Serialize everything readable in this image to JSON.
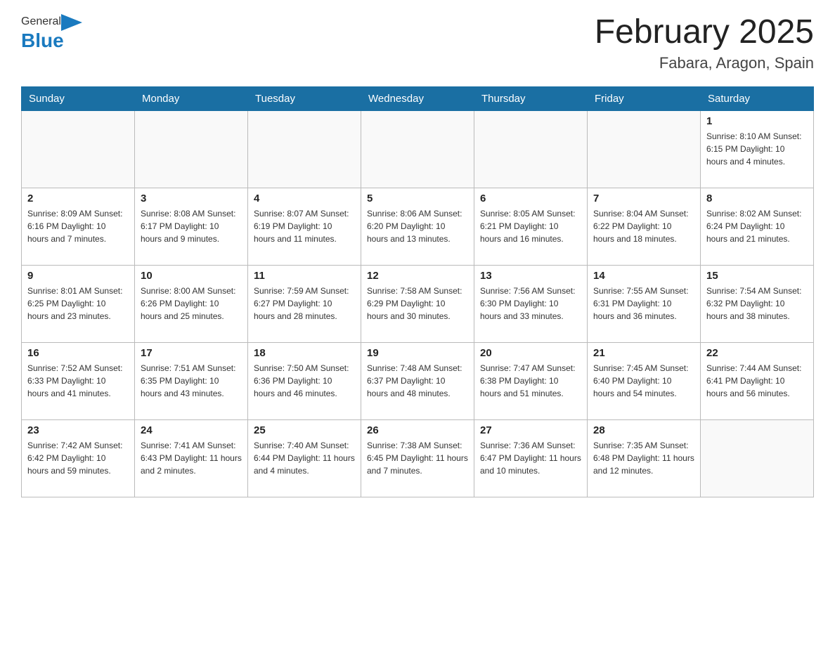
{
  "header": {
    "logo_general": "General",
    "logo_blue": "Blue",
    "month_title": "February 2025",
    "location": "Fabara, Aragon, Spain"
  },
  "weekdays": [
    "Sunday",
    "Monday",
    "Tuesday",
    "Wednesday",
    "Thursday",
    "Friday",
    "Saturday"
  ],
  "weeks": [
    [
      {
        "day": "",
        "info": ""
      },
      {
        "day": "",
        "info": ""
      },
      {
        "day": "",
        "info": ""
      },
      {
        "day": "",
        "info": ""
      },
      {
        "day": "",
        "info": ""
      },
      {
        "day": "",
        "info": ""
      },
      {
        "day": "1",
        "info": "Sunrise: 8:10 AM\nSunset: 6:15 PM\nDaylight: 10 hours and 4 minutes."
      }
    ],
    [
      {
        "day": "2",
        "info": "Sunrise: 8:09 AM\nSunset: 6:16 PM\nDaylight: 10 hours and 7 minutes."
      },
      {
        "day": "3",
        "info": "Sunrise: 8:08 AM\nSunset: 6:17 PM\nDaylight: 10 hours and 9 minutes."
      },
      {
        "day": "4",
        "info": "Sunrise: 8:07 AM\nSunset: 6:19 PM\nDaylight: 10 hours and 11 minutes."
      },
      {
        "day": "5",
        "info": "Sunrise: 8:06 AM\nSunset: 6:20 PM\nDaylight: 10 hours and 13 minutes."
      },
      {
        "day": "6",
        "info": "Sunrise: 8:05 AM\nSunset: 6:21 PM\nDaylight: 10 hours and 16 minutes."
      },
      {
        "day": "7",
        "info": "Sunrise: 8:04 AM\nSunset: 6:22 PM\nDaylight: 10 hours and 18 minutes."
      },
      {
        "day": "8",
        "info": "Sunrise: 8:02 AM\nSunset: 6:24 PM\nDaylight: 10 hours and 21 minutes."
      }
    ],
    [
      {
        "day": "9",
        "info": "Sunrise: 8:01 AM\nSunset: 6:25 PM\nDaylight: 10 hours and 23 minutes."
      },
      {
        "day": "10",
        "info": "Sunrise: 8:00 AM\nSunset: 6:26 PM\nDaylight: 10 hours and 25 minutes."
      },
      {
        "day": "11",
        "info": "Sunrise: 7:59 AM\nSunset: 6:27 PM\nDaylight: 10 hours and 28 minutes."
      },
      {
        "day": "12",
        "info": "Sunrise: 7:58 AM\nSunset: 6:29 PM\nDaylight: 10 hours and 30 minutes."
      },
      {
        "day": "13",
        "info": "Sunrise: 7:56 AM\nSunset: 6:30 PM\nDaylight: 10 hours and 33 minutes."
      },
      {
        "day": "14",
        "info": "Sunrise: 7:55 AM\nSunset: 6:31 PM\nDaylight: 10 hours and 36 minutes."
      },
      {
        "day": "15",
        "info": "Sunrise: 7:54 AM\nSunset: 6:32 PM\nDaylight: 10 hours and 38 minutes."
      }
    ],
    [
      {
        "day": "16",
        "info": "Sunrise: 7:52 AM\nSunset: 6:33 PM\nDaylight: 10 hours and 41 minutes."
      },
      {
        "day": "17",
        "info": "Sunrise: 7:51 AM\nSunset: 6:35 PM\nDaylight: 10 hours and 43 minutes."
      },
      {
        "day": "18",
        "info": "Sunrise: 7:50 AM\nSunset: 6:36 PM\nDaylight: 10 hours and 46 minutes."
      },
      {
        "day": "19",
        "info": "Sunrise: 7:48 AM\nSunset: 6:37 PM\nDaylight: 10 hours and 48 minutes."
      },
      {
        "day": "20",
        "info": "Sunrise: 7:47 AM\nSunset: 6:38 PM\nDaylight: 10 hours and 51 minutes."
      },
      {
        "day": "21",
        "info": "Sunrise: 7:45 AM\nSunset: 6:40 PM\nDaylight: 10 hours and 54 minutes."
      },
      {
        "day": "22",
        "info": "Sunrise: 7:44 AM\nSunset: 6:41 PM\nDaylight: 10 hours and 56 minutes."
      }
    ],
    [
      {
        "day": "23",
        "info": "Sunrise: 7:42 AM\nSunset: 6:42 PM\nDaylight: 10 hours and 59 minutes."
      },
      {
        "day": "24",
        "info": "Sunrise: 7:41 AM\nSunset: 6:43 PM\nDaylight: 11 hours and 2 minutes."
      },
      {
        "day": "25",
        "info": "Sunrise: 7:40 AM\nSunset: 6:44 PM\nDaylight: 11 hours and 4 minutes."
      },
      {
        "day": "26",
        "info": "Sunrise: 7:38 AM\nSunset: 6:45 PM\nDaylight: 11 hours and 7 minutes."
      },
      {
        "day": "27",
        "info": "Sunrise: 7:36 AM\nSunset: 6:47 PM\nDaylight: 11 hours and 10 minutes."
      },
      {
        "day": "28",
        "info": "Sunrise: 7:35 AM\nSunset: 6:48 PM\nDaylight: 11 hours and 12 minutes."
      },
      {
        "day": "",
        "info": ""
      }
    ]
  ]
}
